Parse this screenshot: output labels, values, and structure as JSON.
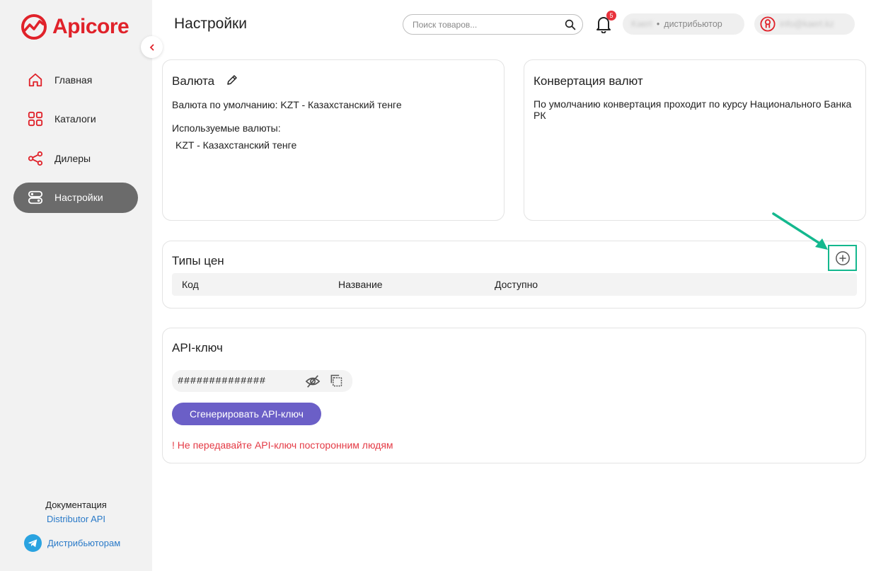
{
  "brand": {
    "name": "Apicore",
    "color": "#e0222a"
  },
  "sidebar": {
    "items": [
      {
        "label": "Главная",
        "icon": "home-icon"
      },
      {
        "label": "Каталоги",
        "icon": "grid-icon"
      },
      {
        "label": "Дилеры",
        "icon": "share-icon"
      },
      {
        "label": "Настройки",
        "icon": "settings-icon",
        "active": true
      }
    ],
    "docs_label": "Документация",
    "docs_link": "Distributor API",
    "telegram_label": "Дистрибьюторам"
  },
  "header": {
    "title": "Настройки",
    "search_placeholder": "Поиск товаров...",
    "notifications_count": "5",
    "distributor_name": "Kaert",
    "distributor_role": "дистрибьютор",
    "user_email": "info@kaert.kz"
  },
  "currency_card": {
    "title": "Валюта",
    "default_currency": "Валюта по умолчанию: KZT - Казахстанский тенге",
    "used_label": "Используемые валюты:",
    "used_currency": "KZT - Казахстанский тенге"
  },
  "conversion_card": {
    "title": "Конвертация валют",
    "text": "По умолчанию конвертация проходит по курсу Национального Банка РК"
  },
  "price_types_card": {
    "title": "Типы цен",
    "columns": [
      "Код",
      "Название",
      "Доступно"
    ]
  },
  "api_card": {
    "title": "API-ключ",
    "key_mask": "##############",
    "generate_label": "Сгенерировать API-ключ",
    "warning": "! Не передавайте API-ключ посторонним людям"
  },
  "colors": {
    "accent_purple": "#6b5fc7",
    "highlight_green": "#14b88e",
    "warning_red": "#e43a45",
    "link_blue": "#2a7ac8"
  }
}
